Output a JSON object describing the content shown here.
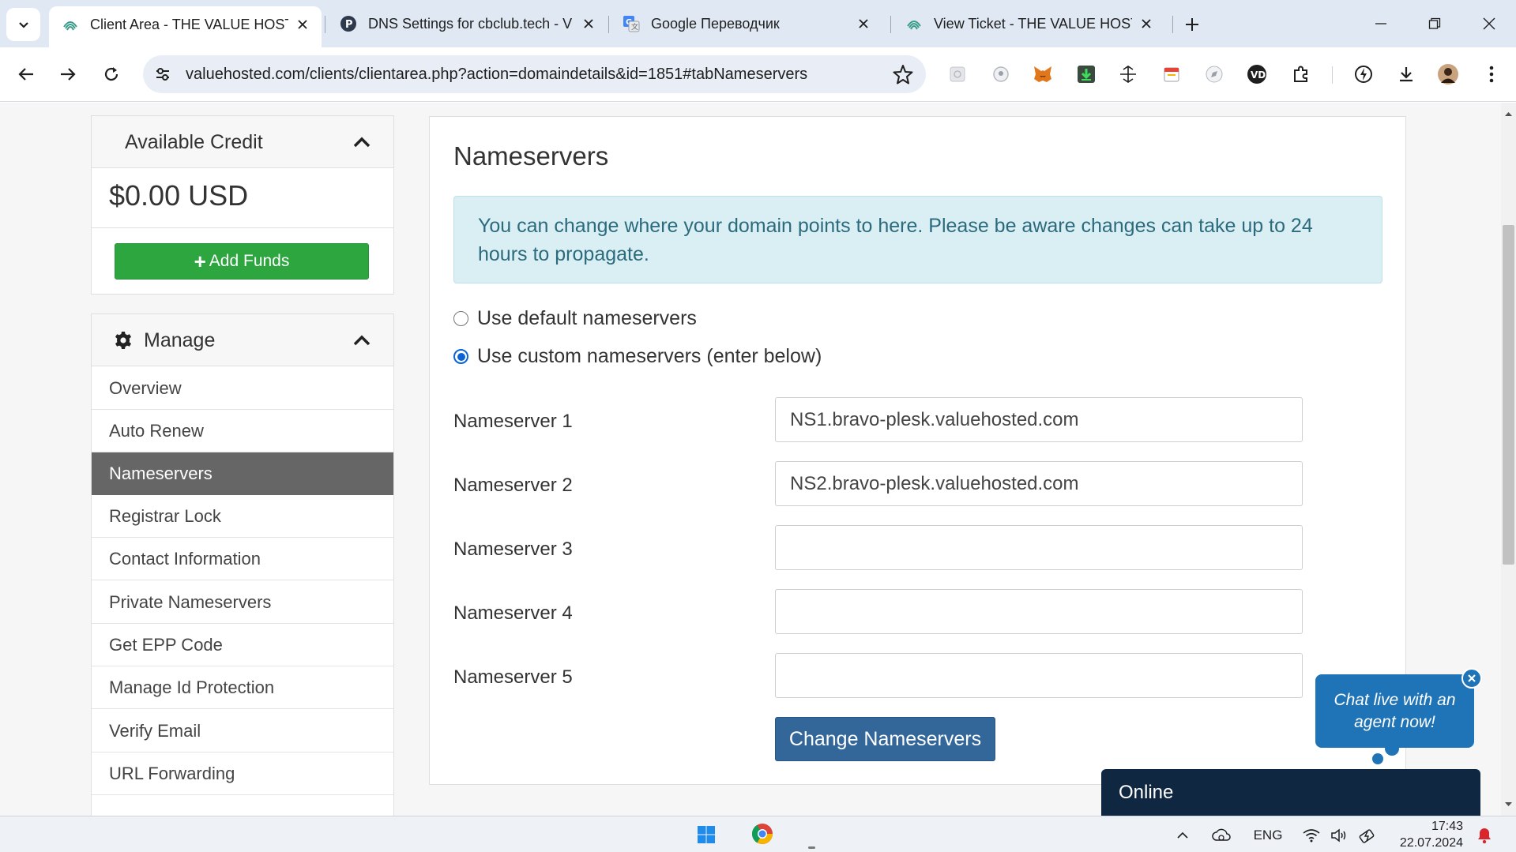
{
  "browser": {
    "tabs": [
      {
        "title": "Client Area - THE VALUE HOSTE",
        "active": true,
        "favicon": "value-hosted-icon"
      },
      {
        "title": "DNS Settings for cbclub.tech - V",
        "active": false,
        "favicon": "p-letter-icon"
      },
      {
        "title": "Google Переводчик",
        "active": false,
        "favicon": "google-translate-icon"
      },
      {
        "title": "View Ticket - THE VALUE HOSTE",
        "active": false,
        "favicon": "value-hosted-icon"
      }
    ],
    "url": "valuehosted.com/clients/clientarea.php?action=domaindetails&id=1851#tabNameservers"
  },
  "sidebar": {
    "credit": {
      "title": "Available Credit",
      "amount": "$0.00 USD",
      "add_funds_label": "Add Funds"
    },
    "manage": {
      "title": "Manage",
      "items": [
        {
          "label": "Overview",
          "active": false
        },
        {
          "label": "Auto Renew",
          "active": false
        },
        {
          "label": "Nameservers",
          "active": true
        },
        {
          "label": "Registrar Lock",
          "active": false
        },
        {
          "label": "Contact Information",
          "active": false
        },
        {
          "label": "Private Nameservers",
          "active": false
        },
        {
          "label": "Get EPP Code",
          "active": false
        },
        {
          "label": "Manage Id Protection",
          "active": false
        },
        {
          "label": "Verify Email",
          "active": false
        },
        {
          "label": "URL Forwarding",
          "active": false
        }
      ]
    }
  },
  "main": {
    "title": "Nameservers",
    "alert": "You can change where your domain points to here. Please be aware changes can take up to 24 hours to propagate.",
    "options": [
      {
        "label": "Use default nameservers",
        "checked": false
      },
      {
        "label": "Use custom nameservers (enter below)",
        "checked": true
      }
    ],
    "nameservers": [
      {
        "label": "Nameserver 1",
        "value": "NS1.bravo-plesk.valuehosted.com"
      },
      {
        "label": "Nameserver 2",
        "value": "NS2.bravo-plesk.valuehosted.com"
      },
      {
        "label": "Nameserver 3",
        "value": ""
      },
      {
        "label": "Nameserver 4",
        "value": ""
      },
      {
        "label": "Nameserver 5",
        "value": ""
      }
    ],
    "submit_label": "Change Nameservers"
  },
  "chat": {
    "prompt": "Chat live with an agent now!",
    "status": "Online"
  },
  "taskbar": {
    "language": "ENG",
    "time": "17:43",
    "date": "22.07.2024"
  },
  "colors": {
    "add_funds": "#2ea640",
    "active_menu": "#666666",
    "alert_bg": "#d9eff3",
    "primary_button": "#336699",
    "chat": "#1f73b7",
    "online_bar": "#0f2740"
  }
}
